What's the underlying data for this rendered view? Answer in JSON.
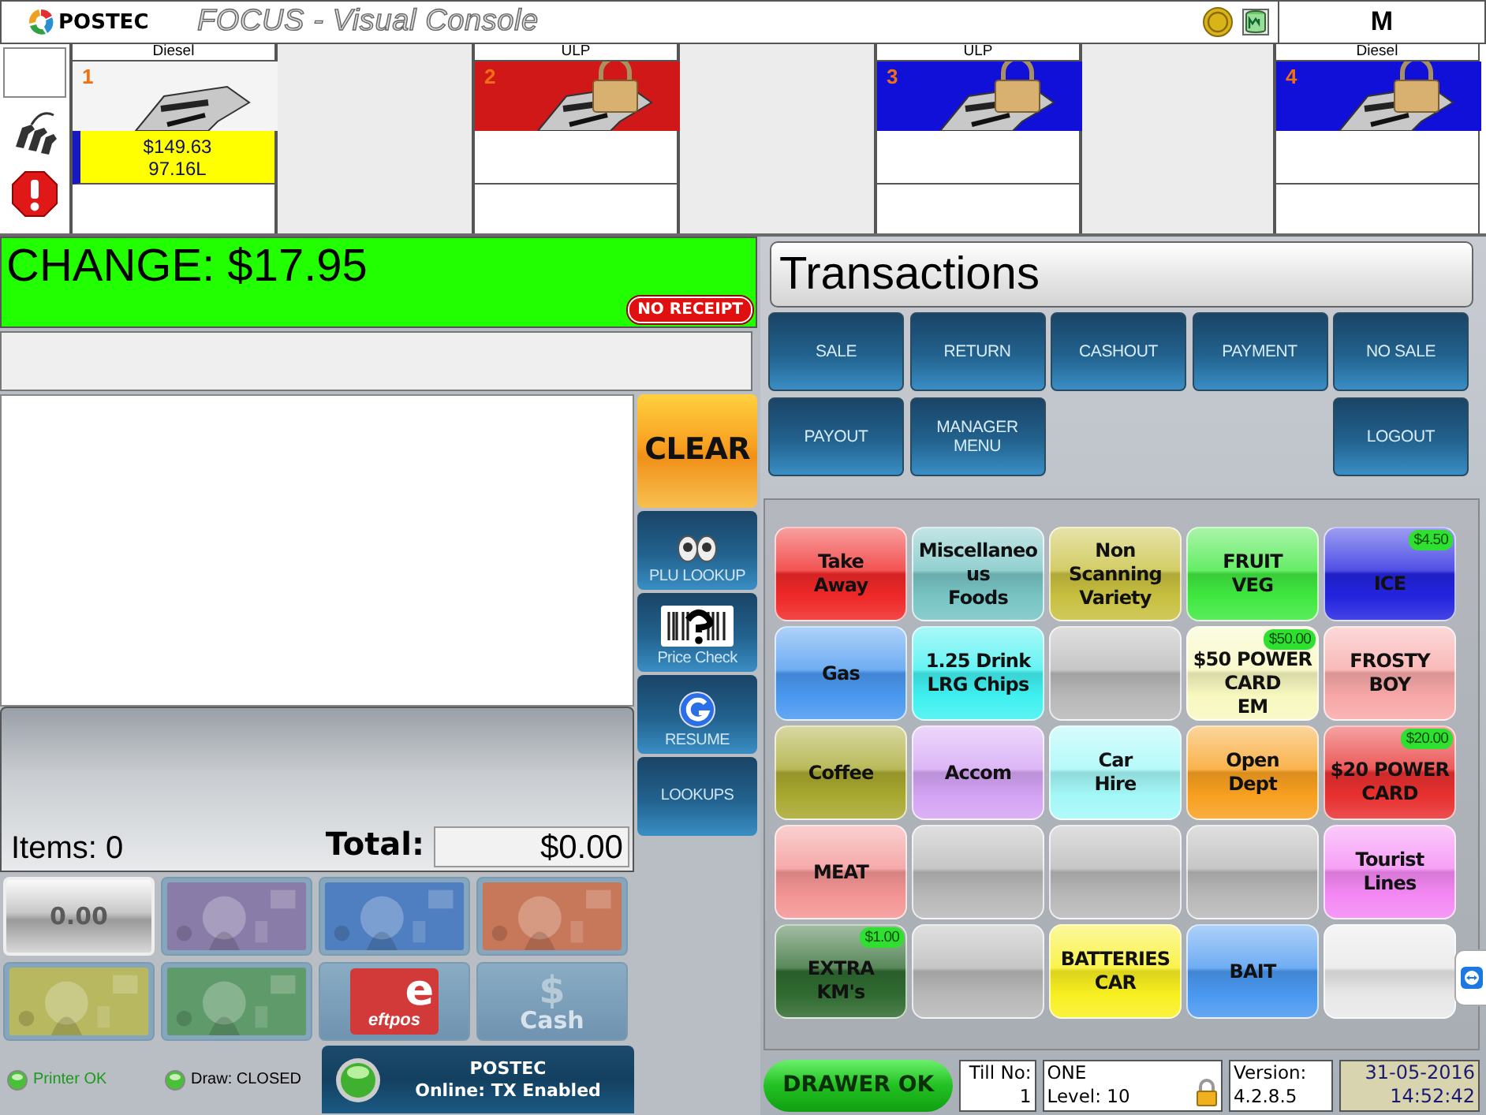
{
  "header": {
    "logo": "POSTEC",
    "title": "FOCUS - Visual Console",
    "operator": "M"
  },
  "pumps": [
    {
      "number": "1",
      "fuel": "Diesel",
      "color": "#f4f4f4",
      "locked": false,
      "amount": "$149.63",
      "volume": "97.16L"
    },
    {
      "number": "2",
      "fuel": "ULP",
      "color": "#d01818",
      "locked": true
    },
    {
      "number": "3",
      "fuel": "ULP",
      "color": "#1010d8",
      "locked": true
    },
    {
      "number": "4",
      "fuel": "Diesel",
      "color": "#1010d8",
      "locked": true
    }
  ],
  "change": {
    "text": "CHANGE: $17.95",
    "badge": "NO RECEIPT"
  },
  "totals": {
    "items": "Items: 0",
    "total_label": "Total:",
    "total": "$0.00"
  },
  "side_buttons": [
    {
      "kind": "clear",
      "label": "CLEAR"
    },
    {
      "kind": "eyes",
      "label": "PLU LOOKUP"
    },
    {
      "kind": "barcode",
      "label": "Price Check"
    },
    {
      "kind": "resume",
      "label": "RESUME"
    },
    {
      "kind": "plain",
      "label": "LOOKUPS"
    }
  ],
  "tenders": [
    {
      "kind": "amount",
      "label": "0.00"
    },
    {
      "kind": "note",
      "color": "#8a7ca8"
    },
    {
      "kind": "note",
      "color": "#4f7fc0"
    },
    {
      "kind": "note",
      "color": "#c8785a"
    },
    {
      "kind": "note",
      "color": "#b8b860"
    },
    {
      "kind": "note",
      "color": "#5f9a6a"
    },
    {
      "kind": "eftpos",
      "mark": "e",
      "label": "eftpos"
    },
    {
      "kind": "cash",
      "symbol": "$",
      "label": "Cash"
    }
  ],
  "status": [
    {
      "label": "Printer OK",
      "ok": true
    },
    {
      "label": "Draw: CLOSED",
      "ok": false
    }
  ],
  "connection": {
    "name": "POSTEC",
    "status": "Online: TX Enabled"
  },
  "transactions": {
    "title": "Transactions",
    "buttons": [
      {
        "kind": "button",
        "label": "SALE"
      },
      {
        "kind": "button",
        "label": "RETURN"
      },
      {
        "kind": "button",
        "label": "CASHOUT"
      },
      {
        "kind": "button",
        "label": "PAYMENT"
      },
      {
        "kind": "button",
        "label": "NO SALE"
      },
      {
        "kind": "button",
        "label": "PAYOUT"
      },
      {
        "kind": "button",
        "label": "MANAGER MENU"
      },
      {
        "kind": "blank"
      },
      {
        "kind": "blank"
      },
      {
        "kind": "button",
        "label": "LOGOUT"
      }
    ]
  },
  "departments": [
    {
      "label": "Take\nAway",
      "color": "#f02828"
    },
    {
      "label": "Miscellaneo\nus\nFoods",
      "color": "#78c4c4"
    },
    {
      "label": "Non\nScanning\nVariety",
      "color": "#c8c040"
    },
    {
      "label": "FRUIT\nVEG",
      "color": "#40e840"
    },
    {
      "label": "ICE",
      "color": "#2424e0",
      "price": "$4.50"
    },
    {
      "label": "Gas",
      "color": "#4a98f0"
    },
    {
      "label": "1.25 Drink\nLRG Chips",
      "color": "#40f0f0"
    },
    {
      "color": "#b8b8b8"
    },
    {
      "label": "$50 POWER\nCARD\nEM",
      "color": "#f8f8c0",
      "price": "$50.00"
    },
    {
      "label": "FROSTY\nBOY",
      "color": "#f8a8a8"
    },
    {
      "label": "Coffee",
      "color": "#a8a830"
    },
    {
      "label": "Accom",
      "color": "#d4a4f4"
    },
    {
      "label": "Car\nHire",
      "color": "#a4f8f8"
    },
    {
      "label": "Open\nDept",
      "color": "#f8a020"
    },
    {
      "label": "$20 POWER\nCARD",
      "color": "#e83030",
      "price": "$20.00"
    },
    {
      "label": "MEAT",
      "color": "#f49494"
    },
    {
      "color": "#b8b8b8"
    },
    {
      "color": "#b8b8b8"
    },
    {
      "color": "#b8b8b8"
    },
    {
      "label": "Tourist\nLines",
      "color": "#f488f4"
    },
    {
      "label": "EXTRA\nKM's",
      "color": "#2f6a30",
      "price": "$1.00"
    },
    {
      "color": "#b8b8b8"
    },
    {
      "label": "BATTERIES\nCAR",
      "color": "#f8f020"
    },
    {
      "label": "BAIT",
      "color": "#4a98f0"
    },
    {
      "color": "#e8e8e8"
    }
  ],
  "footer": {
    "drawer": "DRAWER OK",
    "till_label": "Till No:",
    "till": "1",
    "till_name": "ONE",
    "level": "Level: 10",
    "version_label": "Version:",
    "version": "4.2.8.5",
    "date": "31-05-2016",
    "time": "14:52:42"
  }
}
